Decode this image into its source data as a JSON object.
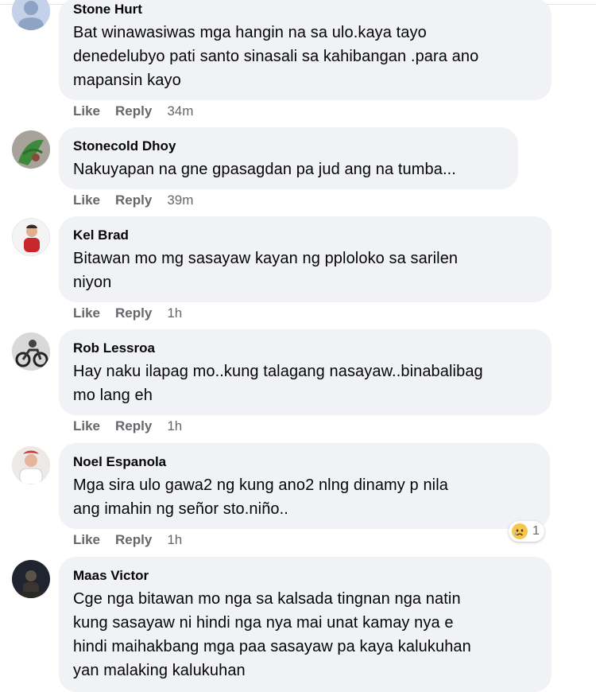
{
  "actions": {
    "like": "Like",
    "reply": "Reply"
  },
  "comments": [
    {
      "author": "Stone Hurt",
      "lines": [
        "Bat winawasiwas mga hangin na sa ulo.kaya tayo",
        "denedelubyo pati santo sinasali sa kahibangan .para ano",
        "mapansin kayo"
      ],
      "time": "34m"
    },
    {
      "author": "Stonecold Dhoy",
      "lines": [
        "Nakuyapan na gne gpasagdan pa jud ang na tumba..."
      ],
      "time": "39m"
    },
    {
      "author": "Kel Brad",
      "lines": [
        "Bitawan mo mg sasayaw kayan ng pploloko sa sarilen",
        "niyon"
      ],
      "time": "1h"
    },
    {
      "author": "Rob Lessroa",
      "lines": [
        "Hay naku ilapag mo..kung talagang nasayaw..binabalibag",
        "mo lang eh"
      ],
      "time": "1h"
    },
    {
      "author": "Noel Espanola",
      "lines": [
        "Mga sira ulo gawa2 ng kung ano2 nlng dinamy p nila",
        "ang imahin ng señor sto.niño.."
      ],
      "time": "1h",
      "reaction_count": "1",
      "reaction_icon": "sad-reaction-icon"
    },
    {
      "author": "Maas Victor",
      "lines": [
        "Cge nga bitawan mo nga sa kalsada tingnan nga natin",
        "kung sasayaw ni hindi nga nya mai unat kamay nya e",
        "hindi maihakbang mga paa sasayaw pa kaya kalukuhan",
        "yan malaking kalukuhan"
      ]
    }
  ],
  "colors": {
    "bubble": "#f0f2f5",
    "meta_text": "#65676b",
    "name_text": "#050505"
  }
}
